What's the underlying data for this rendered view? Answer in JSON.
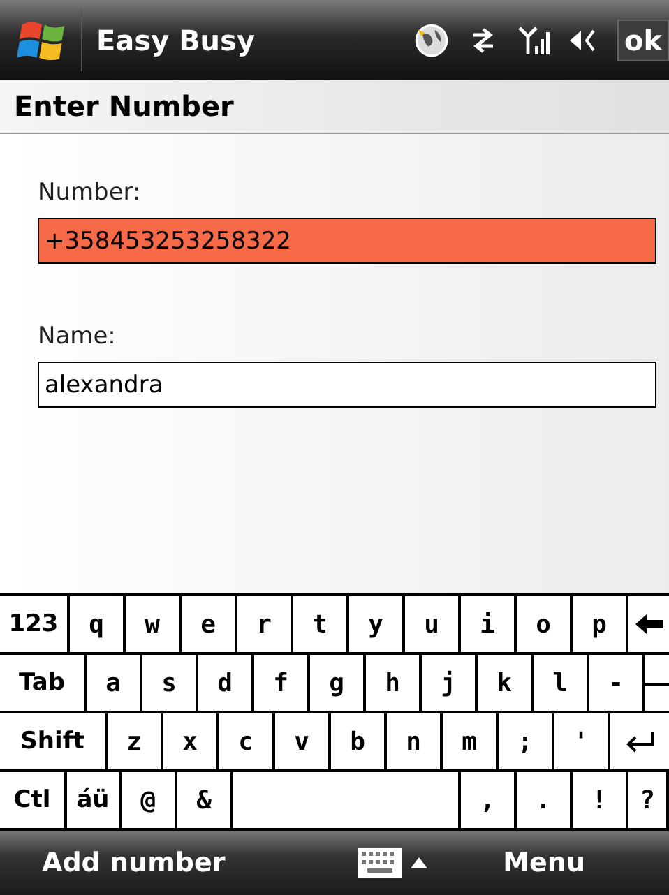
{
  "title_bar": {
    "title": "Easy Busy",
    "ok_label": "ok"
  },
  "header": {
    "title": "Enter Number"
  },
  "form": {
    "fields": [
      {
        "label": "Number:",
        "value": "+358453253258322",
        "highlighted": true
      },
      {
        "label": "Name:",
        "value": "alexandra",
        "highlighted": false
      }
    ]
  },
  "keyboard": {
    "rows": [
      [
        {
          "kind": "function",
          "label": "123"
        },
        {
          "kind": "char",
          "label": "q"
        },
        {
          "kind": "char",
          "label": "w"
        },
        {
          "kind": "char",
          "label": "e"
        },
        {
          "kind": "char",
          "label": "r"
        },
        {
          "kind": "char",
          "label": "t"
        },
        {
          "kind": "char",
          "label": "y"
        },
        {
          "kind": "char",
          "label": "u"
        },
        {
          "kind": "char",
          "label": "i"
        },
        {
          "kind": "char",
          "label": "o"
        },
        {
          "kind": "char",
          "label": "p"
        },
        {
          "kind": "backspace"
        }
      ],
      [
        {
          "kind": "function",
          "label": "Tab"
        },
        {
          "kind": "char",
          "label": "a"
        },
        {
          "kind": "char",
          "label": "s"
        },
        {
          "kind": "char",
          "label": "d"
        },
        {
          "kind": "char",
          "label": "f"
        },
        {
          "kind": "char",
          "label": "g"
        },
        {
          "kind": "char",
          "label": "h"
        },
        {
          "kind": "char",
          "label": "j"
        },
        {
          "kind": "char",
          "label": "k"
        },
        {
          "kind": "char",
          "label": "l"
        },
        {
          "kind": "char",
          "label": "-"
        },
        {
          "kind": "stub"
        }
      ],
      [
        {
          "kind": "function",
          "label": "Shift"
        },
        {
          "kind": "char",
          "label": "z"
        },
        {
          "kind": "char",
          "label": "x"
        },
        {
          "kind": "char",
          "label": "c"
        },
        {
          "kind": "char",
          "label": "v"
        },
        {
          "kind": "char",
          "label": "b"
        },
        {
          "kind": "char",
          "label": "n"
        },
        {
          "kind": "char",
          "label": "m"
        },
        {
          "kind": "char",
          "label": ";"
        },
        {
          "kind": "char",
          "label": "'"
        },
        {
          "kind": "enter"
        }
      ],
      [
        {
          "kind": "function",
          "label": "Ctl"
        },
        {
          "kind": "function",
          "label": "áü"
        },
        {
          "kind": "char",
          "label": "@"
        },
        {
          "kind": "char",
          "label": "&"
        },
        {
          "kind": "space"
        },
        {
          "kind": "char",
          "label": ","
        },
        {
          "kind": "char",
          "label": "."
        },
        {
          "kind": "char",
          "label": "!"
        },
        {
          "kind": "char",
          "label": "?"
        }
      ]
    ]
  },
  "soft_keys": {
    "left": "Add number",
    "right": "Menu"
  }
}
